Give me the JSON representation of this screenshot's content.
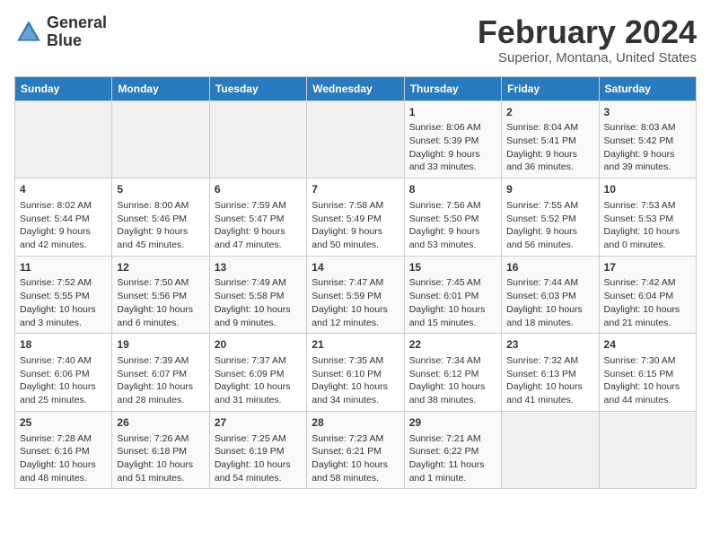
{
  "header": {
    "logo_line1": "General",
    "logo_line2": "Blue",
    "month_title": "February 2024",
    "location": "Superior, Montana, United States"
  },
  "days_of_week": [
    "Sunday",
    "Monday",
    "Tuesday",
    "Wednesday",
    "Thursday",
    "Friday",
    "Saturday"
  ],
  "weeks": [
    [
      {
        "day": "",
        "info": ""
      },
      {
        "day": "",
        "info": ""
      },
      {
        "day": "",
        "info": ""
      },
      {
        "day": "",
        "info": ""
      },
      {
        "day": "1",
        "info": "Sunrise: 8:06 AM\nSunset: 5:39 PM\nDaylight: 9 hours\nand 33 minutes."
      },
      {
        "day": "2",
        "info": "Sunrise: 8:04 AM\nSunset: 5:41 PM\nDaylight: 9 hours\nand 36 minutes."
      },
      {
        "day": "3",
        "info": "Sunrise: 8:03 AM\nSunset: 5:42 PM\nDaylight: 9 hours\nand 39 minutes."
      }
    ],
    [
      {
        "day": "4",
        "info": "Sunrise: 8:02 AM\nSunset: 5:44 PM\nDaylight: 9 hours\nand 42 minutes."
      },
      {
        "day": "5",
        "info": "Sunrise: 8:00 AM\nSunset: 5:46 PM\nDaylight: 9 hours\nand 45 minutes."
      },
      {
        "day": "6",
        "info": "Sunrise: 7:59 AM\nSunset: 5:47 PM\nDaylight: 9 hours\nand 47 minutes."
      },
      {
        "day": "7",
        "info": "Sunrise: 7:58 AM\nSunset: 5:49 PM\nDaylight: 9 hours\nand 50 minutes."
      },
      {
        "day": "8",
        "info": "Sunrise: 7:56 AM\nSunset: 5:50 PM\nDaylight: 9 hours\nand 53 minutes."
      },
      {
        "day": "9",
        "info": "Sunrise: 7:55 AM\nSunset: 5:52 PM\nDaylight: 9 hours\nand 56 minutes."
      },
      {
        "day": "10",
        "info": "Sunrise: 7:53 AM\nSunset: 5:53 PM\nDaylight: 10 hours\nand 0 minutes."
      }
    ],
    [
      {
        "day": "11",
        "info": "Sunrise: 7:52 AM\nSunset: 5:55 PM\nDaylight: 10 hours\nand 3 minutes."
      },
      {
        "day": "12",
        "info": "Sunrise: 7:50 AM\nSunset: 5:56 PM\nDaylight: 10 hours\nand 6 minutes."
      },
      {
        "day": "13",
        "info": "Sunrise: 7:49 AM\nSunset: 5:58 PM\nDaylight: 10 hours\nand 9 minutes."
      },
      {
        "day": "14",
        "info": "Sunrise: 7:47 AM\nSunset: 5:59 PM\nDaylight: 10 hours\nand 12 minutes."
      },
      {
        "day": "15",
        "info": "Sunrise: 7:45 AM\nSunset: 6:01 PM\nDaylight: 10 hours\nand 15 minutes."
      },
      {
        "day": "16",
        "info": "Sunrise: 7:44 AM\nSunset: 6:03 PM\nDaylight: 10 hours\nand 18 minutes."
      },
      {
        "day": "17",
        "info": "Sunrise: 7:42 AM\nSunset: 6:04 PM\nDaylight: 10 hours\nand 21 minutes."
      }
    ],
    [
      {
        "day": "18",
        "info": "Sunrise: 7:40 AM\nSunset: 6:06 PM\nDaylight: 10 hours\nand 25 minutes."
      },
      {
        "day": "19",
        "info": "Sunrise: 7:39 AM\nSunset: 6:07 PM\nDaylight: 10 hours\nand 28 minutes."
      },
      {
        "day": "20",
        "info": "Sunrise: 7:37 AM\nSunset: 6:09 PM\nDaylight: 10 hours\nand 31 minutes."
      },
      {
        "day": "21",
        "info": "Sunrise: 7:35 AM\nSunset: 6:10 PM\nDaylight: 10 hours\nand 34 minutes."
      },
      {
        "day": "22",
        "info": "Sunrise: 7:34 AM\nSunset: 6:12 PM\nDaylight: 10 hours\nand 38 minutes."
      },
      {
        "day": "23",
        "info": "Sunrise: 7:32 AM\nSunset: 6:13 PM\nDaylight: 10 hours\nand 41 minutes."
      },
      {
        "day": "24",
        "info": "Sunrise: 7:30 AM\nSunset: 6:15 PM\nDaylight: 10 hours\nand 44 minutes."
      }
    ],
    [
      {
        "day": "25",
        "info": "Sunrise: 7:28 AM\nSunset: 6:16 PM\nDaylight: 10 hours\nand 48 minutes."
      },
      {
        "day": "26",
        "info": "Sunrise: 7:26 AM\nSunset: 6:18 PM\nDaylight: 10 hours\nand 51 minutes."
      },
      {
        "day": "27",
        "info": "Sunrise: 7:25 AM\nSunset: 6:19 PM\nDaylight: 10 hours\nand 54 minutes."
      },
      {
        "day": "28",
        "info": "Sunrise: 7:23 AM\nSunset: 6:21 PM\nDaylight: 10 hours\nand 58 minutes."
      },
      {
        "day": "29",
        "info": "Sunrise: 7:21 AM\nSunset: 6:22 PM\nDaylight: 11 hours\nand 1 minute."
      },
      {
        "day": "",
        "info": ""
      },
      {
        "day": "",
        "info": ""
      }
    ]
  ]
}
